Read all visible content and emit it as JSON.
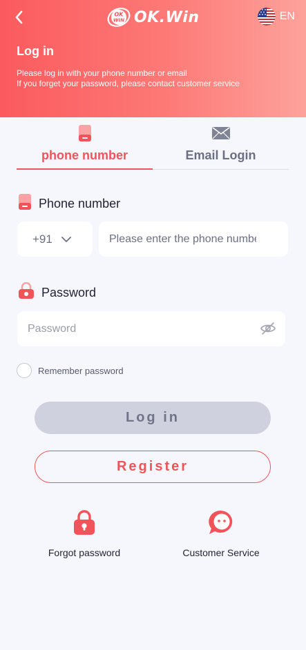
{
  "header": {
    "brand": "OK.Win",
    "brand_badge_line1": "OK",
    "brand_badge_line2": "WIN",
    "language": "EN",
    "title": "Log in",
    "subtitle_line1": "Please log in with your phone number or email",
    "subtitle_line2": "If you forget your password, please contact customer service"
  },
  "tabs": [
    {
      "label": "phone number",
      "icon": "phone-icon",
      "active": true
    },
    {
      "label": "Email Login",
      "icon": "mail-icon",
      "active": false
    }
  ],
  "phone": {
    "label": "Phone number",
    "country_code": "+91",
    "placeholder": "Please enter the phone number",
    "value": ""
  },
  "password": {
    "label": "Password",
    "placeholder": "Password",
    "value": ""
  },
  "remember": {
    "label": "Remember password",
    "checked": false
  },
  "buttons": {
    "login": "Log in",
    "register": "Register"
  },
  "bottom": {
    "forgot": {
      "label": "Forgot password",
      "icon": "padlock-icon"
    },
    "service": {
      "label": "Customer Service",
      "icon": "chat-bubble-icon"
    }
  },
  "colors": {
    "accent": "#f0545a",
    "header_gradient_start": "#fb5a5e",
    "header_gradient_end": "#fda29b",
    "background": "#f6f7fc",
    "login_button_disabled": "#cfd1de"
  }
}
